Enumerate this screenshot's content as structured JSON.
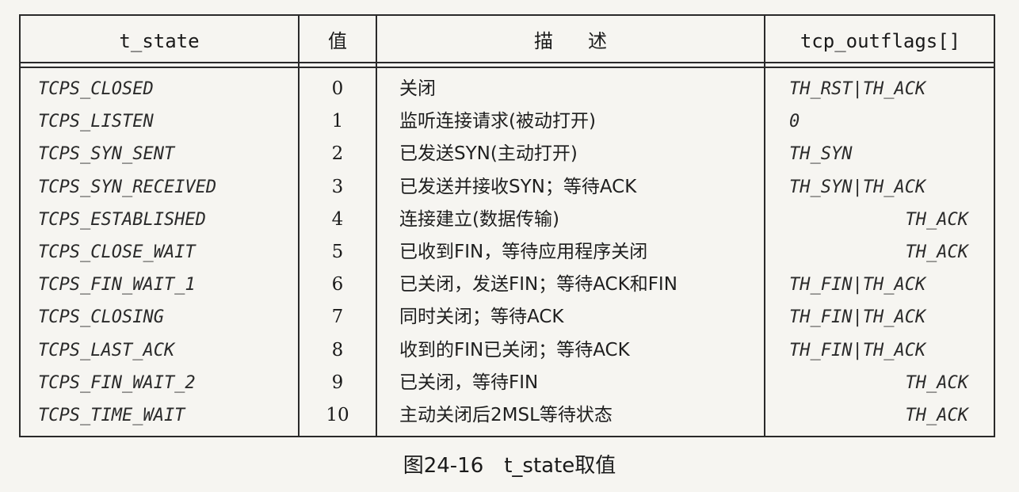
{
  "table": {
    "headers": {
      "state": "t_state",
      "value": "值",
      "description": "描述",
      "flags": "tcp_outflags[]"
    },
    "rows": [
      {
        "state": "TCPS_CLOSED",
        "value": "0",
        "description": "关闭",
        "flags": "TH_RST|TH_ACK",
        "align": "left"
      },
      {
        "state": "TCPS_LISTEN",
        "value": "1",
        "description": "监听连接请求(被动打开)",
        "flags": "0",
        "align": "left"
      },
      {
        "state": "TCPS_SYN_SENT",
        "value": "2",
        "description": "已发送SYN(主动打开)",
        "flags": "TH_SYN",
        "align": "left"
      },
      {
        "state": "TCPS_SYN_RECEIVED",
        "value": "3",
        "description": "已发送并接收SYN；等待ACK",
        "flags": "TH_SYN|TH_ACK",
        "align": "left"
      },
      {
        "state": "TCPS_ESTABLISHED",
        "value": "4",
        "description": "连接建立(数据传输)",
        "flags": "TH_ACK",
        "align": "right"
      },
      {
        "state": "TCPS_CLOSE_WAIT",
        "value": "5",
        "description": "已收到FIN，等待应用程序关闭",
        "flags": "TH_ACK",
        "align": "right"
      },
      {
        "state": "TCPS_FIN_WAIT_1",
        "value": "6",
        "description": "已关闭，发送FIN；等待ACK和FIN",
        "flags": "TH_FIN|TH_ACK",
        "align": "left"
      },
      {
        "state": "TCPS_CLOSING",
        "value": "7",
        "description": "同时关闭；等待ACK",
        "flags": "TH_FIN|TH_ACK",
        "align": "left"
      },
      {
        "state": "TCPS_LAST_ACK",
        "value": "8",
        "description": "收到的FIN已关闭；等待ACK",
        "flags": "TH_FIN|TH_ACK",
        "align": "left"
      },
      {
        "state": "TCPS_FIN_WAIT_2",
        "value": "9",
        "description": "已关闭，等待FIN",
        "flags": "TH_ACK",
        "align": "right"
      },
      {
        "state": "TCPS_TIME_WAIT",
        "value": "10",
        "description": "主动关闭后2MSL等待状态",
        "flags": "TH_ACK",
        "align": "right"
      }
    ]
  },
  "caption": "图24-16　t_state取值"
}
